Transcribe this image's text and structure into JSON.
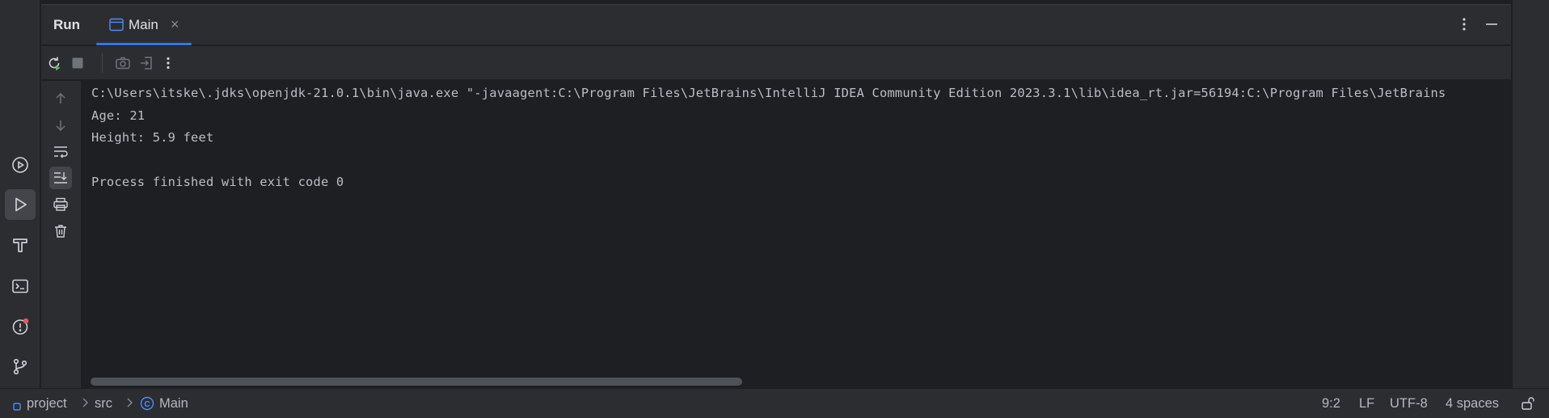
{
  "tool_window": {
    "title": "Run",
    "tab": {
      "label": "Main",
      "close_symbol": "×"
    }
  },
  "icons": {
    "left_stripe": [
      "run-services-icon",
      "run-icon",
      "build-icon",
      "terminal-icon",
      "problems-icon",
      "git-icon"
    ],
    "toolbar": [
      "rerun-icon",
      "stop-icon",
      "screenshot-icon",
      "exit-icon",
      "more-vertical-icon"
    ],
    "gutter": [
      "arrow-up-icon",
      "arrow-down-icon",
      "soft-wrap-icon",
      "scroll-to-end-icon",
      "print-icon",
      "trash-icon"
    ]
  },
  "colors": {
    "accent": "#3574f0",
    "run_green": "#5fb865",
    "error_red": "#e55765",
    "panel_bg": "#2b2d30",
    "editor_bg": "#1e1f22"
  },
  "console": {
    "lines": [
      "C:\\Users\\itske\\.jdks\\openjdk-21.0.1\\bin\\java.exe \"-javaagent:C:\\Program Files\\JetBrains\\IntelliJ IDEA Community Edition 2023.3.1\\lib\\idea_rt.jar=56194:C:\\Program Files\\JetBrains",
      "Age: 21",
      "Height: 5.9 feet",
      "",
      "Process finished with exit code 0"
    ]
  },
  "status_bar": {
    "breadcrumb": {
      "project": "project",
      "folder": "src",
      "class": "Main",
      "class_glyph": "C"
    },
    "caret_position": "9:2",
    "line_separator": "LF",
    "encoding": "UTF-8",
    "indent": "4 spaces"
  }
}
